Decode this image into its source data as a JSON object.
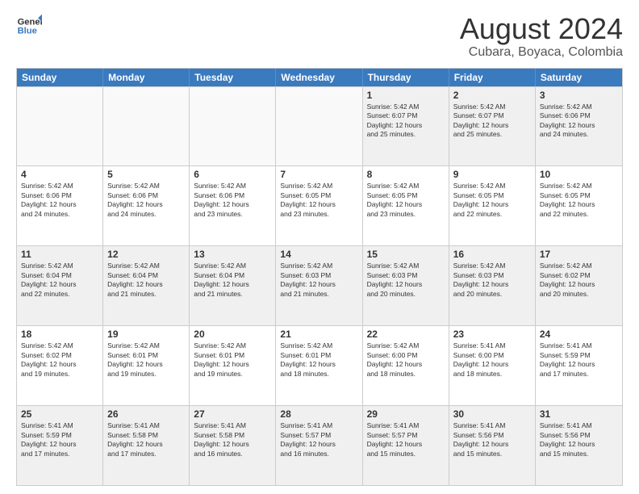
{
  "logo": {
    "line1": "General",
    "line2": "Blue"
  },
  "title": "August 2024",
  "location": "Cubara, Boyaca, Colombia",
  "days_of_week": [
    "Sunday",
    "Monday",
    "Tuesday",
    "Wednesday",
    "Thursday",
    "Friday",
    "Saturday"
  ],
  "weeks": [
    [
      {
        "day": "",
        "empty": true
      },
      {
        "day": "",
        "empty": true
      },
      {
        "day": "",
        "empty": true
      },
      {
        "day": "",
        "empty": true
      },
      {
        "day": "1",
        "lines": [
          "Sunrise: 5:42 AM",
          "Sunset: 6:07 PM",
          "Daylight: 12 hours",
          "and 25 minutes."
        ]
      },
      {
        "day": "2",
        "lines": [
          "Sunrise: 5:42 AM",
          "Sunset: 6:07 PM",
          "Daylight: 12 hours",
          "and 25 minutes."
        ]
      },
      {
        "day": "3",
        "lines": [
          "Sunrise: 5:42 AM",
          "Sunset: 6:06 PM",
          "Daylight: 12 hours",
          "and 24 minutes."
        ]
      }
    ],
    [
      {
        "day": "4",
        "lines": [
          "Sunrise: 5:42 AM",
          "Sunset: 6:06 PM",
          "Daylight: 12 hours",
          "and 24 minutes."
        ]
      },
      {
        "day": "5",
        "lines": [
          "Sunrise: 5:42 AM",
          "Sunset: 6:06 PM",
          "Daylight: 12 hours",
          "and 24 minutes."
        ]
      },
      {
        "day": "6",
        "lines": [
          "Sunrise: 5:42 AM",
          "Sunset: 6:06 PM",
          "Daylight: 12 hours",
          "and 23 minutes."
        ]
      },
      {
        "day": "7",
        "lines": [
          "Sunrise: 5:42 AM",
          "Sunset: 6:05 PM",
          "Daylight: 12 hours",
          "and 23 minutes."
        ]
      },
      {
        "day": "8",
        "lines": [
          "Sunrise: 5:42 AM",
          "Sunset: 6:05 PM",
          "Daylight: 12 hours",
          "and 23 minutes."
        ]
      },
      {
        "day": "9",
        "lines": [
          "Sunrise: 5:42 AM",
          "Sunset: 6:05 PM",
          "Daylight: 12 hours",
          "and 22 minutes."
        ]
      },
      {
        "day": "10",
        "lines": [
          "Sunrise: 5:42 AM",
          "Sunset: 6:05 PM",
          "Daylight: 12 hours",
          "and 22 minutes."
        ]
      }
    ],
    [
      {
        "day": "11",
        "lines": [
          "Sunrise: 5:42 AM",
          "Sunset: 6:04 PM",
          "Daylight: 12 hours",
          "and 22 minutes."
        ]
      },
      {
        "day": "12",
        "lines": [
          "Sunrise: 5:42 AM",
          "Sunset: 6:04 PM",
          "Daylight: 12 hours",
          "and 21 minutes."
        ]
      },
      {
        "day": "13",
        "lines": [
          "Sunrise: 5:42 AM",
          "Sunset: 6:04 PM",
          "Daylight: 12 hours",
          "and 21 minutes."
        ]
      },
      {
        "day": "14",
        "lines": [
          "Sunrise: 5:42 AM",
          "Sunset: 6:03 PM",
          "Daylight: 12 hours",
          "and 21 minutes."
        ]
      },
      {
        "day": "15",
        "lines": [
          "Sunrise: 5:42 AM",
          "Sunset: 6:03 PM",
          "Daylight: 12 hours",
          "and 20 minutes."
        ]
      },
      {
        "day": "16",
        "lines": [
          "Sunrise: 5:42 AM",
          "Sunset: 6:03 PM",
          "Daylight: 12 hours",
          "and 20 minutes."
        ]
      },
      {
        "day": "17",
        "lines": [
          "Sunrise: 5:42 AM",
          "Sunset: 6:02 PM",
          "Daylight: 12 hours",
          "and 20 minutes."
        ]
      }
    ],
    [
      {
        "day": "18",
        "lines": [
          "Sunrise: 5:42 AM",
          "Sunset: 6:02 PM",
          "Daylight: 12 hours",
          "and 19 minutes."
        ]
      },
      {
        "day": "19",
        "lines": [
          "Sunrise: 5:42 AM",
          "Sunset: 6:01 PM",
          "Daylight: 12 hours",
          "and 19 minutes."
        ]
      },
      {
        "day": "20",
        "lines": [
          "Sunrise: 5:42 AM",
          "Sunset: 6:01 PM",
          "Daylight: 12 hours",
          "and 19 minutes."
        ]
      },
      {
        "day": "21",
        "lines": [
          "Sunrise: 5:42 AM",
          "Sunset: 6:01 PM",
          "Daylight: 12 hours",
          "and 18 minutes."
        ]
      },
      {
        "day": "22",
        "lines": [
          "Sunrise: 5:42 AM",
          "Sunset: 6:00 PM",
          "Daylight: 12 hours",
          "and 18 minutes."
        ]
      },
      {
        "day": "23",
        "lines": [
          "Sunrise: 5:41 AM",
          "Sunset: 6:00 PM",
          "Daylight: 12 hours",
          "and 18 minutes."
        ]
      },
      {
        "day": "24",
        "lines": [
          "Sunrise: 5:41 AM",
          "Sunset: 5:59 PM",
          "Daylight: 12 hours",
          "and 17 minutes."
        ]
      }
    ],
    [
      {
        "day": "25",
        "lines": [
          "Sunrise: 5:41 AM",
          "Sunset: 5:59 PM",
          "Daylight: 12 hours",
          "and 17 minutes."
        ]
      },
      {
        "day": "26",
        "lines": [
          "Sunrise: 5:41 AM",
          "Sunset: 5:58 PM",
          "Daylight: 12 hours",
          "and 17 minutes."
        ]
      },
      {
        "day": "27",
        "lines": [
          "Sunrise: 5:41 AM",
          "Sunset: 5:58 PM",
          "Daylight: 12 hours",
          "and 16 minutes."
        ]
      },
      {
        "day": "28",
        "lines": [
          "Sunrise: 5:41 AM",
          "Sunset: 5:57 PM",
          "Daylight: 12 hours",
          "and 16 minutes."
        ]
      },
      {
        "day": "29",
        "lines": [
          "Sunrise: 5:41 AM",
          "Sunset: 5:57 PM",
          "Daylight: 12 hours",
          "and 15 minutes."
        ]
      },
      {
        "day": "30",
        "lines": [
          "Sunrise: 5:41 AM",
          "Sunset: 5:56 PM",
          "Daylight: 12 hours",
          "and 15 minutes."
        ]
      },
      {
        "day": "31",
        "lines": [
          "Sunrise: 5:41 AM",
          "Sunset: 5:56 PM",
          "Daylight: 12 hours",
          "and 15 minutes."
        ]
      }
    ]
  ],
  "colors": {
    "header_bg": "#3a7abf",
    "header_text": "#ffffff",
    "border": "#cccccc",
    "shaded": "#f0f0f0",
    "empty": "#f9f9f9",
    "text": "#333333"
  }
}
